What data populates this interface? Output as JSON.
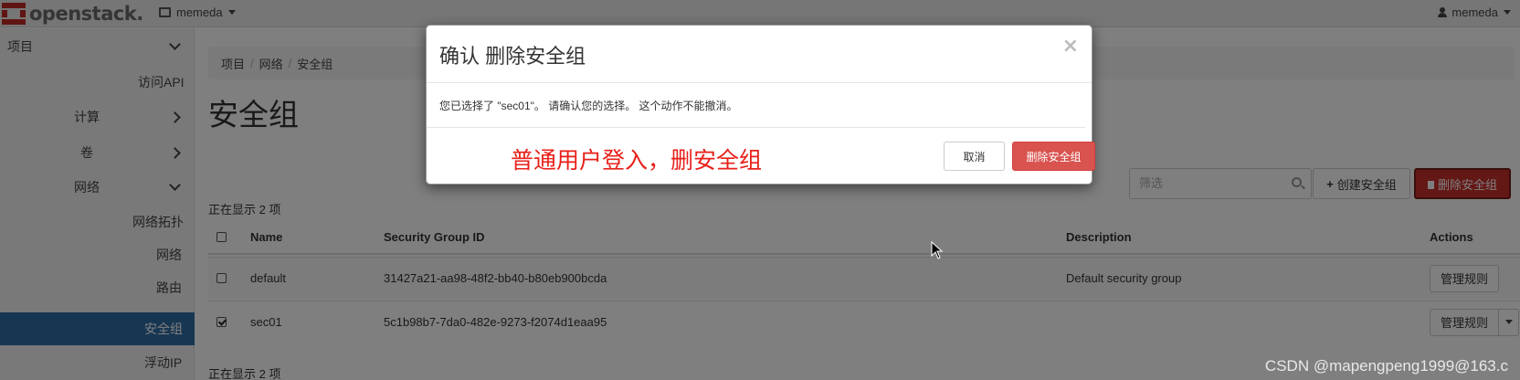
{
  "navbar": {
    "brand": "openstack.",
    "project": "memeda",
    "user": "memeda"
  },
  "sidebar": {
    "project": "项目",
    "access_api": "访问API",
    "compute": "计算",
    "volumes": "卷",
    "network": "网络",
    "network_topology": "网络拓扑",
    "networks": "网络",
    "routers": "路由",
    "security_groups": "安全组",
    "floating_ips": "浮动IP"
  },
  "breadcrumb": [
    "项目",
    "网络",
    "安全组"
  ],
  "page_title": "安全组",
  "filter": {
    "placeholder": "筛选"
  },
  "toolbar": {
    "create_label": "创建安全组",
    "delete_label": "删除安全组"
  },
  "summary_top": "正在显示 2 项",
  "summary_bottom": "正在显示 2 项",
  "table": {
    "headers": [
      "Name",
      "Security Group ID",
      "Description",
      "Actions"
    ],
    "rows": [
      {
        "name": "default",
        "id": "31427a21-aa98-48f2-bb40-b80eb900bcda",
        "description": "Default security group",
        "action": "管理规则",
        "checked": false
      },
      {
        "name": "sec01",
        "id": "5c1b98b7-7da0-482e-9273-f2074d1eaa95",
        "description": "",
        "action": "管理规则",
        "checked": true
      }
    ]
  },
  "modal": {
    "title": "确认 删除安全组",
    "body": "您已选择了 \"sec01\"。 请确认您的选择。 这个动作不能撤消。",
    "annotation": "普通用户登入，删安全组",
    "cancel_label": "取消",
    "confirm_label": "删除安全组",
    "close_glyph": "×"
  },
  "watermark": "CSDN @mapengpeng1999@163.c",
  "colors": {
    "brand_red": "#c12b27",
    "danger": "#d9534f",
    "sidebar_active": "#2e6da4",
    "annotation_red": "#e8201a"
  }
}
